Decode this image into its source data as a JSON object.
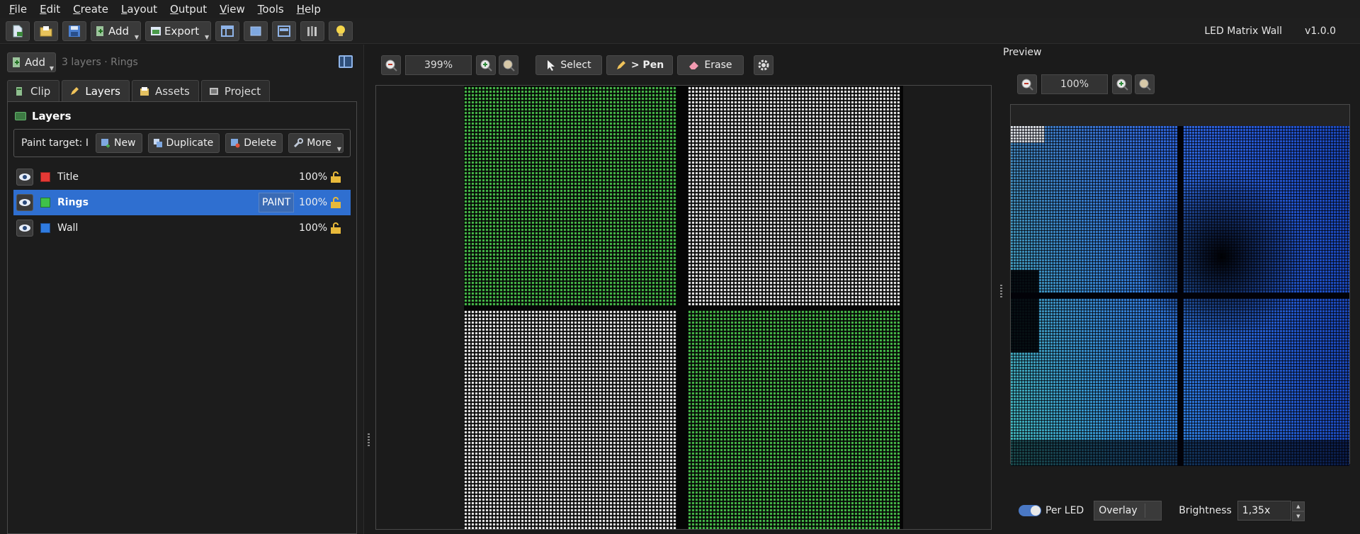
{
  "menu": {
    "items": [
      {
        "first": "F",
        "rest": "ile"
      },
      {
        "first": "E",
        "rest": "dit"
      },
      {
        "first": "C",
        "rest": "reate"
      },
      {
        "first": "L",
        "rest": "ayout"
      },
      {
        "first": "O",
        "rest": "utput"
      },
      {
        "first": "V",
        "rest": "iew"
      },
      {
        "first": "T",
        "rest": "ools"
      },
      {
        "first": "H",
        "rest": "elp"
      }
    ]
  },
  "toolbar": {
    "add_label": "Add",
    "export_label": "Export",
    "app_title": "LED Matrix Wall",
    "version": "v1.0.0"
  },
  "left": {
    "add_label": "Add",
    "summary": "3 layers · Rings",
    "tabs": [
      {
        "label": "Clip"
      },
      {
        "label": "Layers"
      },
      {
        "label": "Assets"
      },
      {
        "label": "Project"
      }
    ],
    "active_tab": "Layers",
    "panel_title": "Layers",
    "paint_target_label": "Paint target: I",
    "actions": {
      "new": "New",
      "duplicate": "Duplicate",
      "delete": "Delete",
      "more": "More"
    },
    "layers": [
      {
        "name": "Title",
        "color": "#e53935",
        "opacity": "100%",
        "selected": false,
        "badge": ""
      },
      {
        "name": "Rings",
        "color": "#3fc14a",
        "opacity": "100%",
        "selected": true,
        "badge": "PAINT"
      },
      {
        "name": "Wall",
        "color": "#2f7be0",
        "opacity": "100%",
        "selected": false,
        "badge": ""
      }
    ]
  },
  "editor": {
    "zoom": "399%",
    "tools": {
      "select": "Select",
      "pen": "> Pen",
      "erase": "Erase"
    },
    "led_colors": {
      "green": "#4cc94f",
      "white": "#ffffff",
      "black": "#050505"
    }
  },
  "preview": {
    "title": "Preview",
    "zoom": "100%",
    "per_led_label": "Per LED",
    "blend_mode": "Overlay",
    "brightness_label": "Brightness",
    "brightness_value": "1,35x"
  },
  "colors": {
    "accent": "#2f6fd0",
    "lock": "#e8b93a"
  }
}
